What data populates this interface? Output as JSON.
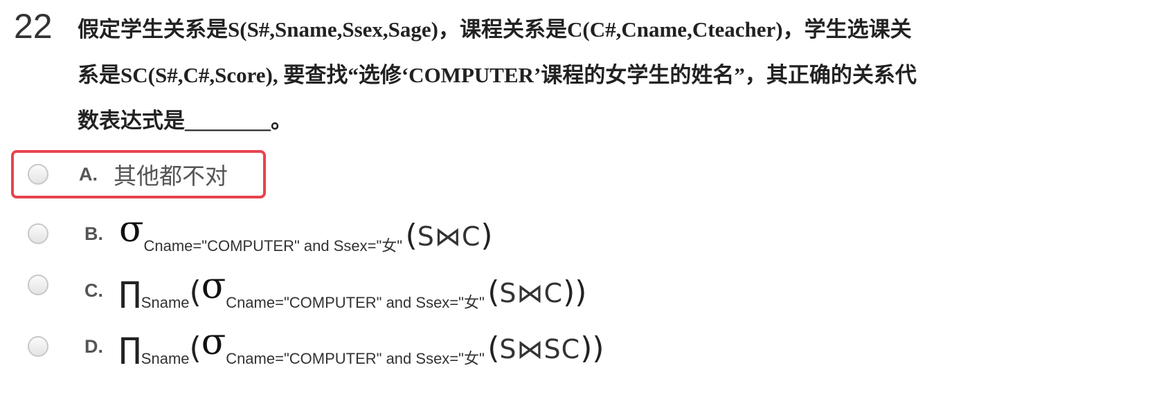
{
  "question": {
    "number": "22",
    "stem_lines": [
      "假定学生关系是S(S#,Sname,Ssex,Sage)，课程关系是C(C#,Cname,Cteacher)，学生选课关",
      "系是SC(S#,C#,Score), 要查找“选修‘COMPUTER’课程的女学生的姓名”，其正确的关系代",
      "数表达式是________。"
    ]
  },
  "options": [
    {
      "letter": "A.",
      "text": "其他都不对",
      "selected_box": true
    },
    {
      "letter": "B.",
      "sigma": "σ",
      "condition": "Cname=\"COMPUTER\" and Ssex=\"女\"",
      "paren_open": "(",
      "relation": "S⋈C",
      "paren_close": ")"
    },
    {
      "letter": "C.",
      "pi": "∏",
      "projection": "Sname",
      "outer_open": "(",
      "sigma": "σ",
      "condition": "Cname=\"COMPUTER\" and Ssex=\"女\"",
      "paren_open": "(",
      "relation": "S⋈C",
      "paren_close": "))"
    },
    {
      "letter": "D.",
      "pi": "∏",
      "projection": "Sname",
      "outer_open": "(",
      "sigma": "σ",
      "condition": "Cname=\"COMPUTER\" and Ssex=\"女\"",
      "paren_open": "(",
      "relation": "S⋈SC",
      "paren_close": "))"
    }
  ],
  "colors": {
    "selection_border": "#e8434f",
    "radio_border": "#c8c8c8"
  }
}
